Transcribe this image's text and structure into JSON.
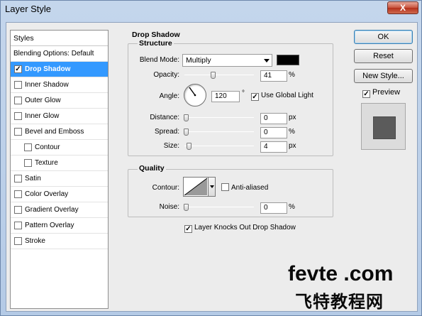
{
  "window": {
    "title": "Layer Style",
    "close_label": "X"
  },
  "styles": {
    "header": "Styles",
    "items": [
      {
        "label": "Blending Options: Default",
        "checkbox": false,
        "checked": false,
        "sub": false,
        "selected": false
      },
      {
        "label": "Drop Shadow",
        "checkbox": true,
        "checked": true,
        "sub": false,
        "selected": true
      },
      {
        "label": "Inner Shadow",
        "checkbox": true,
        "checked": false,
        "sub": false,
        "selected": false
      },
      {
        "label": "Outer Glow",
        "checkbox": true,
        "checked": false,
        "sub": false,
        "selected": false
      },
      {
        "label": "Inner Glow",
        "checkbox": true,
        "checked": false,
        "sub": false,
        "selected": false
      },
      {
        "label": "Bevel and Emboss",
        "checkbox": true,
        "checked": false,
        "sub": false,
        "selected": false
      },
      {
        "label": "Contour",
        "checkbox": true,
        "checked": false,
        "sub": true,
        "selected": false
      },
      {
        "label": "Texture",
        "checkbox": true,
        "checked": false,
        "sub": true,
        "selected": false
      },
      {
        "label": "Satin",
        "checkbox": true,
        "checked": false,
        "sub": false,
        "selected": false
      },
      {
        "label": "Color Overlay",
        "checkbox": true,
        "checked": false,
        "sub": false,
        "selected": false
      },
      {
        "label": "Gradient Overlay",
        "checkbox": true,
        "checked": false,
        "sub": false,
        "selected": false
      },
      {
        "label": "Pattern Overlay",
        "checkbox": true,
        "checked": false,
        "sub": false,
        "selected": false
      },
      {
        "label": "Stroke",
        "checkbox": true,
        "checked": false,
        "sub": false,
        "selected": false
      }
    ]
  },
  "buttons": {
    "ok": "OK",
    "reset": "Reset",
    "new_style": "New Style...",
    "preview": "Preview",
    "preview_checked": "✓"
  },
  "panel": {
    "title": "Drop Shadow",
    "structure": {
      "label": "Structure",
      "blend_mode_label": "Blend Mode:",
      "blend_mode_value": "Multiply",
      "shadow_color": "#000000",
      "opacity_label": "Opacity:",
      "opacity_value": "41",
      "opacity_unit": "%",
      "angle_label": "Angle:",
      "angle_value": "120",
      "angle_unit": "°",
      "global_light_label": "Use Global Light",
      "global_light_checked": "✓",
      "distance_label": "Distance:",
      "distance_value": "0",
      "distance_unit": "px",
      "spread_label": "Spread:",
      "spread_value": "0",
      "spread_unit": "%",
      "size_label": "Size:",
      "size_value": "4",
      "size_unit": "px"
    },
    "quality": {
      "label": "Quality",
      "contour_label": "Contour:",
      "anti_aliased_label": "Anti-aliased",
      "noise_label": "Noise:",
      "noise_value": "0",
      "noise_unit": "%",
      "knockout_label": "Layer Knocks Out Drop Shadow",
      "knockout_checked": "✓"
    }
  },
  "watermark": {
    "line1": "fevte .com",
    "line2": "飞特教程网"
  },
  "colors": {
    "selection": "#3399ff",
    "title_gradient_top": "#c4d6ec",
    "dialog_bg": "#ececec"
  }
}
